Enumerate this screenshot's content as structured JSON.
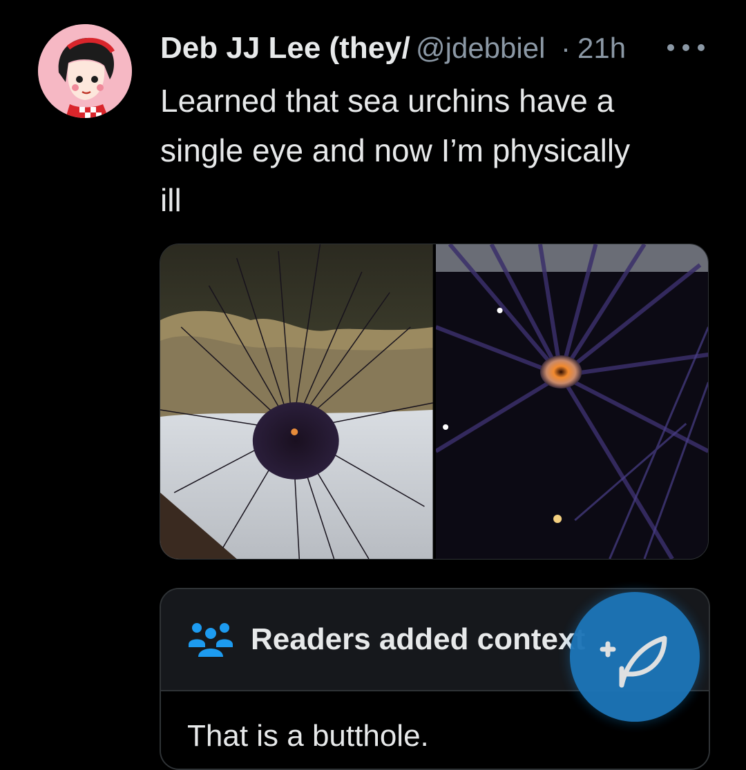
{
  "tweet": {
    "author_name": "Deb JJ Lee (they/them)",
    "author_handle": "@jdebbiel",
    "separator": "·",
    "timestamp": "21h",
    "text": "Learned that sea urchins have a\nsingle eye and now I’m physically\nill"
  },
  "icons": {
    "more": "more-horizontal-icon",
    "readers": "people-group-icon",
    "compose": "feather-compose-icon"
  },
  "note": {
    "title": "Readers added context",
    "body": "That is a butthole."
  },
  "colors": {
    "background": "#000000",
    "text_primary": "#e7e9ea",
    "text_secondary": "#8b98a5",
    "accent": "#1d9bf0",
    "fab": "#1d75b8"
  }
}
